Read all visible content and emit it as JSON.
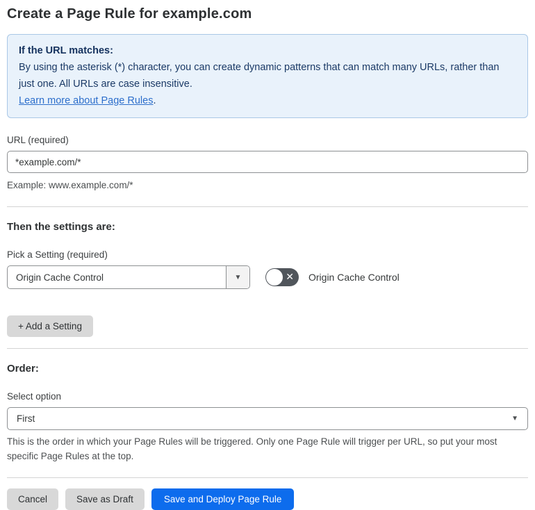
{
  "page": {
    "title": "Create a Page Rule for example.com"
  },
  "info_box": {
    "heading": "If the URL matches:",
    "body": "By using the asterisk (*) character, you can create dynamic patterns that can match many URLs, rather than just one. All URLs are case insensitive.",
    "link_label": "Learn more about Page Rules",
    "link_suffix": "."
  },
  "url_field": {
    "label": "URL (required)",
    "value": "*example.com/*",
    "helper": "Example: www.example.com/*"
  },
  "settings_section": {
    "heading": "Then the settings are:",
    "picker_label": "Pick a Setting (required)",
    "selected_setting": "Origin Cache Control",
    "toggle_label": "Origin Cache Control",
    "toggle_state": "off",
    "add_setting_label": "+ Add a Setting"
  },
  "order_section": {
    "heading": "Order:",
    "select_label": "Select option",
    "selected_option": "First",
    "helper": "This is the order in which your Page Rules will be triggered. Only one Page Rule will trigger per URL, so put your most specific Page Rules at the top."
  },
  "footer": {
    "cancel_label": "Cancel",
    "save_draft_label": "Save as Draft",
    "save_deploy_label": "Save and Deploy Page Rule"
  },
  "icons": {
    "chevron_down": "▼",
    "toggle_off_x": "✕"
  },
  "colors": {
    "primary_blue": "#0d6ced",
    "info_bg": "#e9f2fb",
    "info_border": "#a9c7e6",
    "info_text": "#1b3a66",
    "link_blue": "#2c6ecb",
    "toggle_off_bg": "#50555b",
    "button_gray": "#d8d8d8"
  }
}
